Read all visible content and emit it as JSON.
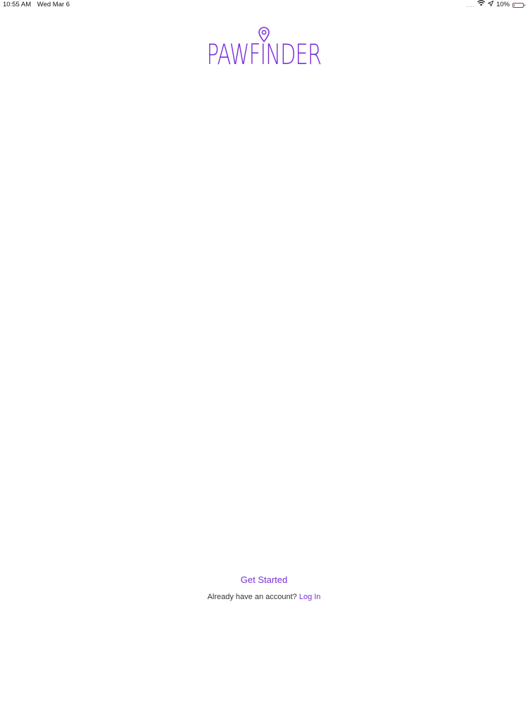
{
  "status_bar": {
    "time": "10:55 AM",
    "date": "Wed Mar 6",
    "signal": "....",
    "battery_percent": "10%",
    "battery_level": 0.1,
    "icons": [
      "wifi-icon",
      "location-arrow-icon",
      "battery-icon"
    ]
  },
  "logo": {
    "text": "PAWFINDER",
    "icon": "map-pin-icon",
    "color": "#7b2fd6"
  },
  "actions": {
    "get_started_label": "Get Started",
    "login_prompt": "Already have an account?",
    "login_label": "Log In"
  },
  "colors": {
    "accent": "#7b2fd6",
    "battery_low": "#e53935"
  }
}
